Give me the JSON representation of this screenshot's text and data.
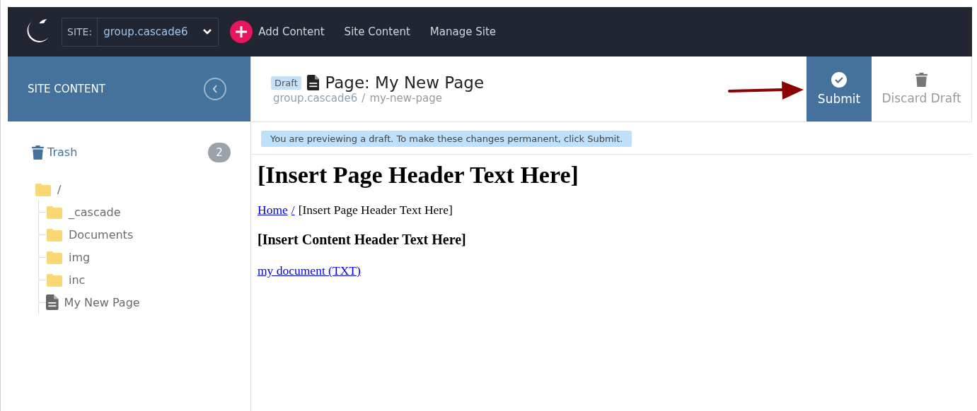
{
  "topbar": {
    "site_label": "SITE:",
    "site_value": "group.cascade6",
    "nav": [
      "Add Content",
      "Site Content",
      "Manage Site"
    ]
  },
  "sidebar": {
    "title": "SITE CONTENT",
    "trash": {
      "label": "Trash",
      "count": "2"
    },
    "tree": {
      "label": "/",
      "kind": "folder",
      "children": [
        {
          "label": "_cascade",
          "kind": "folder"
        },
        {
          "label": "Documents",
          "kind": "folder"
        },
        {
          "label": "img",
          "kind": "folder"
        },
        {
          "label": "inc",
          "kind": "folder"
        },
        {
          "label": "My New Page",
          "kind": "page"
        }
      ]
    }
  },
  "header": {
    "badge": "Draft",
    "title": "Page: My New Page",
    "path": [
      "group.cascade6",
      "my-new-page"
    ],
    "path_separator": "/",
    "actions": [
      {
        "label": "Submit",
        "kind": "submit"
      },
      {
        "label": "Discard Draft",
        "kind": "discard"
      }
    ]
  },
  "notice": "You are previewing a draft. To make these changes permanent, click Submit.",
  "preview": {
    "heading": "[Insert Page Header Text Here]",
    "breadcrumb": {
      "link": "Home",
      "separator": "/",
      "current": "[Insert Page Header Text Here]"
    },
    "subheading": "[Insert Content Header Text Here]",
    "link": "my document (TXT)"
  }
}
